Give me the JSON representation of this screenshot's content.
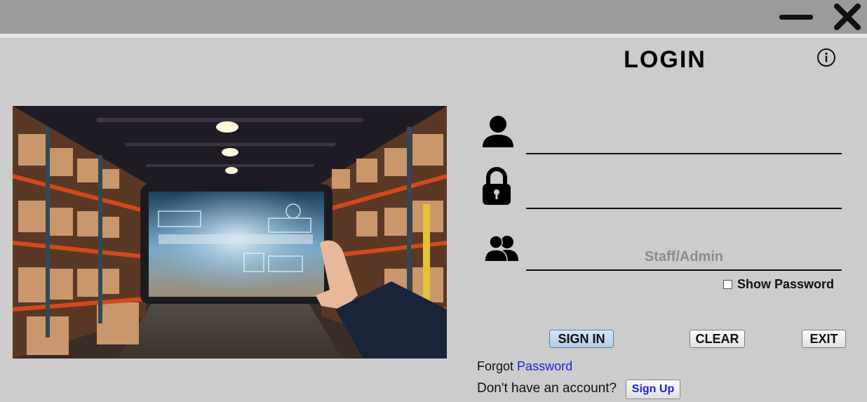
{
  "window": {
    "minimize_icon": "minimize-icon",
    "close_icon": "close-icon"
  },
  "header": {
    "title": "LOGIN",
    "info_icon": "info-icon"
  },
  "hero_image": {
    "icon": "warehouse-tablet-photo"
  },
  "form": {
    "username": {
      "icon": "user-icon",
      "value": "",
      "placeholder": ""
    },
    "password": {
      "icon": "lock-icon",
      "value": "",
      "placeholder": ""
    },
    "role": {
      "icon": "users-icon",
      "value": "",
      "placeholder": "Staff/Admin"
    },
    "show_password_label": "Show Password",
    "show_password_checked": false
  },
  "actions": {
    "sign_in": "SIGN IN",
    "clear": "CLEAR",
    "exit": "EXIT"
  },
  "footer": {
    "forgot_prefix": "Forgot",
    "forgot_link": "Password",
    "signup_prompt": "Don't have an account?",
    "signup_button": "Sign Up"
  },
  "colors": {
    "background": "#cccccc",
    "titlebar": "#9b9b9b",
    "link": "#1f1fd6"
  }
}
